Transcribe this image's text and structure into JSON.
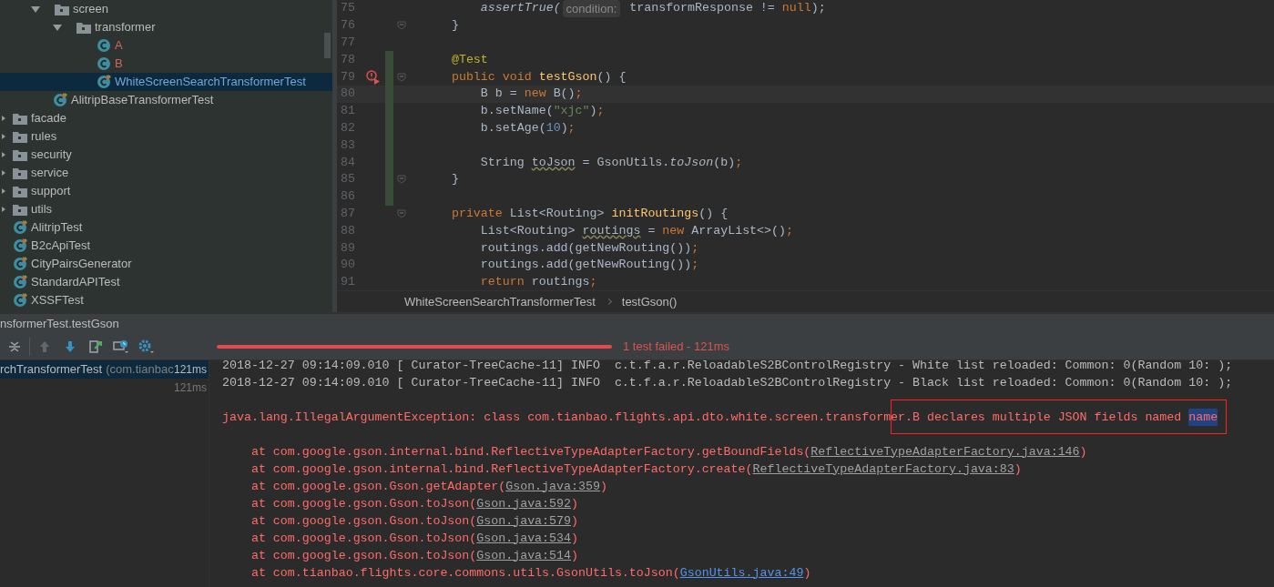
{
  "project_tree": {
    "subfolder_items": [
      {
        "label": "screen",
        "kind": "folder",
        "expanded": true,
        "selected": false,
        "children": [
          {
            "label": "transformer",
            "kind": "folder",
            "expanded": true,
            "selected": false,
            "children": [
              {
                "label": "A",
                "kind": "class",
                "color": "#d2655a",
                "selected": false
              },
              {
                "label": "B",
                "kind": "class",
                "color": "#d2655a",
                "selected": false
              },
              {
                "label": "WhiteScreenSearchTransformerTest",
                "kind": "test",
                "selected": true
              }
            ]
          }
        ]
      },
      {
        "label": "AlitripBaseTransformerTest",
        "kind": "test",
        "color": "#bbbbbb",
        "selected": false
      }
    ],
    "items": [
      {
        "label": "facade",
        "kind": "folder",
        "expanded": false,
        "selected": false
      },
      {
        "label": "rules",
        "kind": "folder",
        "expanded": false,
        "selected": false
      },
      {
        "label": "security",
        "kind": "folder",
        "expanded": false,
        "selected": false
      },
      {
        "label": "service",
        "kind": "folder",
        "expanded": false,
        "selected": false
      },
      {
        "label": "support",
        "kind": "folder",
        "expanded": false,
        "selected": false
      },
      {
        "label": "utils",
        "kind": "folder",
        "expanded": false,
        "selected": false
      },
      {
        "label": "AlitripTest",
        "kind": "test",
        "color": "#bbbbbb",
        "selected": false
      },
      {
        "label": "B2cApiTest",
        "kind": "test",
        "color": "#bbbbbb",
        "selected": false
      },
      {
        "label": "CityPairsGenerator",
        "kind": "test",
        "color": "#bbbbbb",
        "selected": false
      },
      {
        "label": "StandardAPITest",
        "kind": "test",
        "color": "#bbbbbb",
        "selected": false
      },
      {
        "label": "XSSFTest",
        "kind": "test",
        "color": "#bbbbbb",
        "selected": false
      }
    ]
  },
  "editor": {
    "lines": [
      {
        "number": "75",
        "changed": false,
        "fold": false,
        "current": false,
        "error": false,
        "tokens": [
          {
            "text": "        assertTrue(",
            "kind": "italic"
          },
          {
            "text": "condition:",
            "kind": "hint"
          },
          {
            "text": " transformResponse != ",
            "kind": "plain"
          },
          {
            "text": "null",
            "kind": "keyword"
          },
          {
            "text": ");",
            "kind": "plain"
          }
        ]
      },
      {
        "number": "76",
        "changed": false,
        "fold": true,
        "current": false,
        "error": false,
        "tokens": [
          {
            "text": "    }",
            "kind": "plain"
          }
        ]
      },
      {
        "number": "77",
        "changed": false,
        "fold": false,
        "current": false,
        "error": false
      },
      {
        "number": "78",
        "changed": true,
        "fold": false,
        "current": false,
        "error": false,
        "tokens": [
          {
            "text": "    @Test",
            "kind": "annotation"
          }
        ]
      },
      {
        "number": "79",
        "changed": true,
        "fold": true,
        "current": false,
        "error": true,
        "tokens": [
          {
            "text": "    public void ",
            "kind": "keyword"
          },
          {
            "text": "testGson",
            "kind": "method"
          },
          {
            "text": "() {",
            "kind": "plain"
          }
        ]
      },
      {
        "number": "80",
        "changed": true,
        "fold": false,
        "current": true,
        "error": false,
        "tokens": [
          {
            "text": "        B b = ",
            "kind": "plain"
          },
          {
            "text": "new ",
            "kind": "keyword"
          },
          {
            "text": "B()",
            "kind": "plain"
          },
          {
            "text": ";",
            "kind": "keyword"
          }
        ]
      },
      {
        "number": "81",
        "changed": true,
        "fold": false,
        "current": false,
        "error": false,
        "tokens": [
          {
            "text": "        b.setName(",
            "kind": "plain"
          },
          {
            "text": "\"xjc\"",
            "kind": "string"
          },
          {
            "text": ")",
            "kind": "plain"
          },
          {
            "text": ";",
            "kind": "keyword"
          }
        ]
      },
      {
        "number": "82",
        "changed": true,
        "fold": false,
        "current": false,
        "error": false,
        "tokens": [
          {
            "text": "        b.setAge(",
            "kind": "plain"
          },
          {
            "text": "10",
            "kind": "number"
          },
          {
            "text": ")",
            "kind": "plain"
          },
          {
            "text": ";",
            "kind": "keyword"
          }
        ]
      },
      {
        "number": "83",
        "changed": true,
        "fold": false,
        "current": false,
        "error": false
      },
      {
        "number": "84",
        "changed": true,
        "fold": false,
        "current": false,
        "error": false,
        "tokens": [
          {
            "text": "        String ",
            "kind": "plain"
          },
          {
            "text": "toJson",
            "kind": "unused"
          },
          {
            "text": " = GsonUtils.",
            "kind": "plain"
          },
          {
            "text": "toJson",
            "kind": "italic"
          },
          {
            "text": "(b)",
            "kind": "plain"
          },
          {
            "text": ";",
            "kind": "keyword"
          }
        ]
      },
      {
        "number": "85",
        "changed": true,
        "fold": true,
        "current": false,
        "error": false,
        "tokens": [
          {
            "text": "    }",
            "kind": "plain"
          }
        ]
      },
      {
        "number": "86",
        "changed": true,
        "fold": false,
        "current": false,
        "error": false
      },
      {
        "number": "87",
        "changed": false,
        "fold": true,
        "current": false,
        "error": false,
        "tokens": [
          {
            "text": "    private ",
            "kind": "keyword"
          },
          {
            "text": "List<Routing> ",
            "kind": "plain"
          },
          {
            "text": "initRoutings",
            "kind": "method"
          },
          {
            "text": "() {",
            "kind": "plain"
          }
        ]
      },
      {
        "number": "88",
        "changed": false,
        "fold": false,
        "current": false,
        "error": false,
        "tokens": [
          {
            "text": "        List<Routing> ",
            "kind": "plain"
          },
          {
            "text": "routings",
            "kind": "unused"
          },
          {
            "text": " = ",
            "kind": "plain"
          },
          {
            "text": "new ",
            "kind": "keyword"
          },
          {
            "text": "ArrayList<>()",
            "kind": "plain"
          },
          {
            "text": ";",
            "kind": "keyword"
          }
        ]
      },
      {
        "number": "89",
        "changed": false,
        "fold": false,
        "current": false,
        "error": false,
        "tokens": [
          {
            "text": "        routings.add(getNewRouting())",
            "kind": "plain"
          },
          {
            "text": ";",
            "kind": "keyword"
          }
        ]
      },
      {
        "number": "90",
        "changed": false,
        "fold": false,
        "current": false,
        "error": false,
        "tokens": [
          {
            "text": "        routings.add(getNewRouting())",
            "kind": "plain"
          },
          {
            "text": ";",
            "kind": "keyword"
          }
        ]
      },
      {
        "number": "91",
        "changed": false,
        "fold": false,
        "current": false,
        "error": false,
        "tokens": [
          {
            "text": "        return ",
            "kind": "keyword"
          },
          {
            "text": "routings",
            "kind": "plain"
          },
          {
            "text": ";",
            "kind": "keyword"
          }
        ]
      }
    ],
    "breadcrumbs": [
      "WhiteScreenSearchTransformerTest",
      "testGson()"
    ]
  },
  "run_panel": {
    "title": "nsformerTest.testGson",
    "status": "1 test failed - 121ms",
    "passed": false,
    "tests": [
      {
        "name": "rchTransformerTest",
        "package": "(com.tianbac",
        "time": "121ms",
        "selected": true
      },
      {
        "time": "121ms",
        "selected": false
      }
    ],
    "console": [
      {
        "kind": "info",
        "text": "2018-12-27 09:14:09.010 [ Curator-TreeCache-11] INFO  c.t.f.a.r.ReloadableS2BControlRegistry - White list reloaded: Common: 0(Random 10: );"
      },
      {
        "kind": "info",
        "text": "2018-12-27 09:14:09.010 [ Curator-TreeCache-11] INFO  c.t.f.a.r.ReloadableS2BControlRegistry - Black list reloaded: Common: 0(Random 10: );"
      },
      {
        "kind": "blank"
      },
      {
        "kind": "error",
        "text": "java.lang.IllegalArgumentException: class com.tianbao.flights.api.dto.white.screen.transformer.B declares multiple JSON fields named ",
        "selected_text": "name"
      },
      {
        "kind": "blank"
      },
      {
        "kind": "stack",
        "text": "    at com.google.gson.internal.bind.ReflectiveTypeAdapterFactory.getBoundFields(",
        "link": "ReflectiveTypeAdapterFactory.java:146",
        "suffix": ")",
        "local": false
      },
      {
        "kind": "stack",
        "text": "    at com.google.gson.internal.bind.ReflectiveTypeAdapterFactory.create(",
        "link": "ReflectiveTypeAdapterFactory.java:83",
        "suffix": ")",
        "local": false
      },
      {
        "kind": "stack",
        "text": "    at com.google.gson.Gson.getAdapter(",
        "link": "Gson.java:359",
        "suffix": ")",
        "local": false
      },
      {
        "kind": "stack",
        "text": "    at com.google.gson.Gson.toJson(",
        "link": "Gson.java:592",
        "suffix": ")",
        "local": false
      },
      {
        "kind": "stack",
        "text": "    at com.google.gson.Gson.toJson(",
        "link": "Gson.java:579",
        "suffix": ")",
        "local": false
      },
      {
        "kind": "stack",
        "text": "    at com.google.gson.Gson.toJson(",
        "link": "Gson.java:534",
        "suffix": ")",
        "local": false
      },
      {
        "kind": "stack",
        "text": "    at com.google.gson.Gson.toJson(",
        "link": "Gson.java:514",
        "suffix": ")",
        "local": false
      },
      {
        "kind": "stack",
        "text": "    at com.tianbao.flights.core.commons.utils.GsonUtils.toJson(",
        "link": "GsonUtils.java:49",
        "suffix": ")",
        "local": true
      }
    ]
  }
}
